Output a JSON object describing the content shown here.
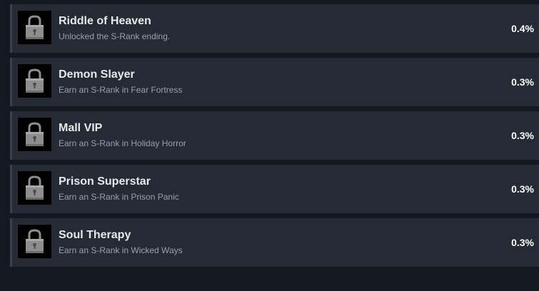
{
  "achievements": [
    {
      "title": "Riddle of Heaven",
      "description": "Unlocked the S-Rank ending.",
      "percent": "0.4%",
      "icon": "padlock-icon",
      "locked": true
    },
    {
      "title": "Demon Slayer",
      "description": "Earn an S-Rank in Fear Fortress",
      "percent": "0.3%",
      "icon": "padlock-icon",
      "locked": true
    },
    {
      "title": "Mall VIP",
      "description": "Earn an S-Rank in Holiday Horror",
      "percent": "0.3%",
      "icon": "padlock-icon",
      "locked": true
    },
    {
      "title": "Prison Superstar",
      "description": "Earn an S-Rank in Prison Panic",
      "percent": "0.3%",
      "icon": "padlock-icon",
      "locked": true
    },
    {
      "title": "Soul Therapy",
      "description": "Earn an S-Rank in Wicked Ways",
      "percent": "0.3%",
      "icon": "padlock-icon",
      "locked": true
    }
  ],
  "colors": {
    "page_background": "#141820",
    "row_background": "#252a35",
    "title_text": "#e6e8ea",
    "description_text": "#9aa1ab",
    "percent_text": "#ffffff"
  }
}
